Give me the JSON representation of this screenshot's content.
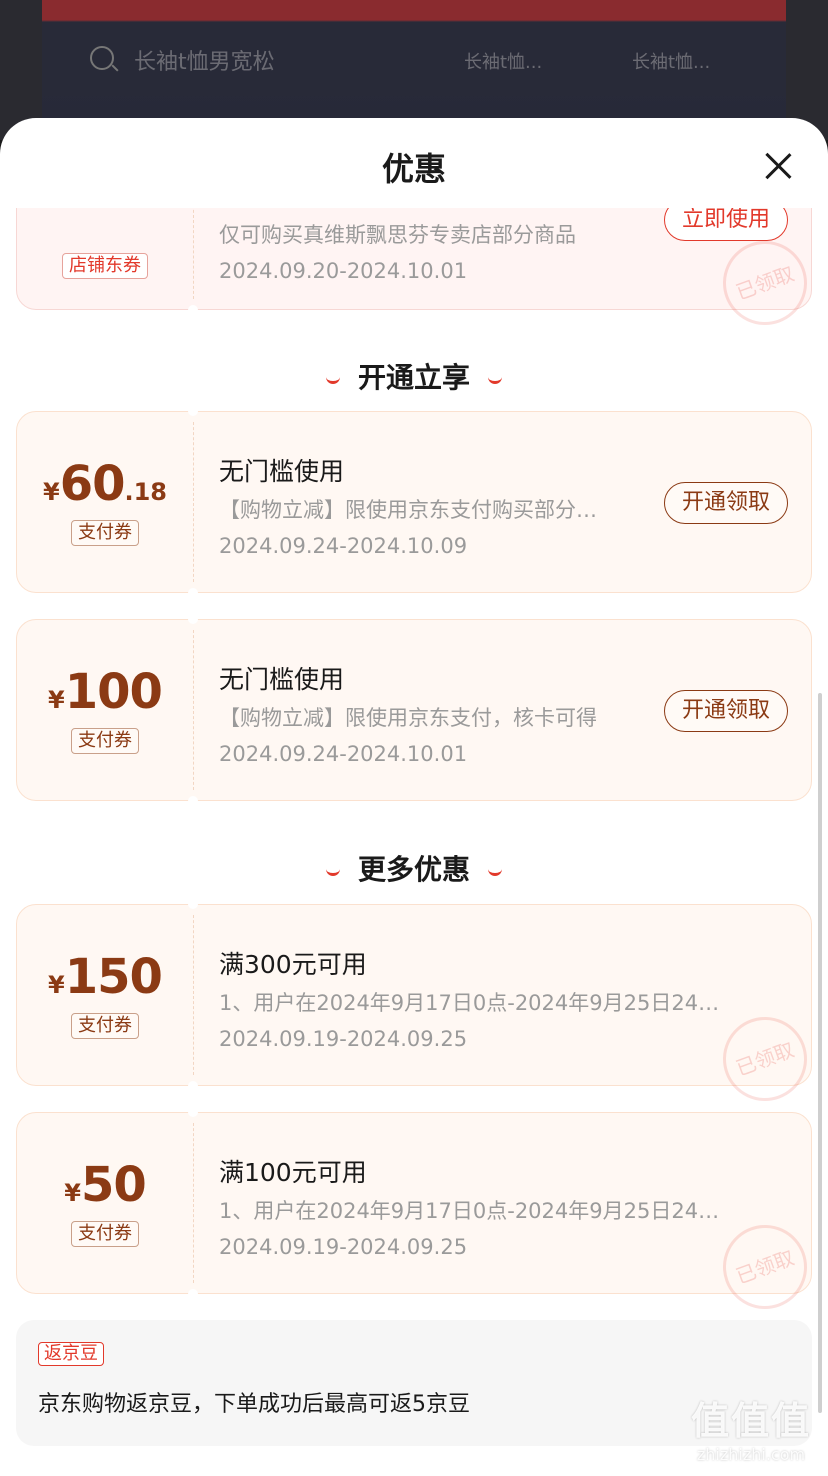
{
  "background": {
    "search_query": "长袖t恤男宽松",
    "suggestion1": "长袖t恤...",
    "suggestion2": "长袖t恤..."
  },
  "sheet": {
    "title": "优惠"
  },
  "top_coupon": {
    "tag": "店铺东券",
    "desc": "仅可购买真维斯飘思芬专卖店部分商品",
    "date": "2024.09.20-2024.10.01",
    "button": "立即使用",
    "stamp": "已领取"
  },
  "section1": {
    "title": "开通立享"
  },
  "coupons_open": [
    {
      "currency": "¥",
      "amount_int": "60",
      "amount_dec": ".18",
      "tag": "支付券",
      "title": "无门槛使用",
      "desc": "【购物立减】限使用京东支付购买部分…",
      "date": "2024.09.24-2024.10.09",
      "button": "开通领取"
    },
    {
      "currency": "¥",
      "amount_int": "100",
      "amount_dec": "",
      "tag": "支付券",
      "title": "无门槛使用",
      "desc": "【购物立减】限使用京东支付，核卡可得",
      "date": "2024.09.24-2024.10.01",
      "button": "开通领取"
    }
  ],
  "section2": {
    "title": "更多优惠"
  },
  "coupons_more": [
    {
      "currency": "¥",
      "amount_int": "150",
      "tag": "支付券",
      "title": "满300元可用",
      "desc": "1、用户在2024年9月17日0点-2024年9月25日24…",
      "date": "2024.09.19-2024.09.25",
      "stamp": "已领取"
    },
    {
      "currency": "¥",
      "amount_int": "50",
      "tag": "支付券",
      "title": "满100元可用",
      "desc": "1、用户在2024年9月17日0点-2024年9月25日24…",
      "date": "2024.09.19-2024.09.25",
      "stamp": "已领取"
    }
  ],
  "jingdou": {
    "tag": "返京豆",
    "text": "京东购物返京豆，下单成功后最高可返5京豆"
  },
  "watermark": {
    "logo": "值值值",
    "url": "zhizhizhi.com"
  },
  "colors": {
    "accent_red": "#e2392b",
    "coupon_brown": "#8b3a14",
    "coupon_bg": "#fff8f3"
  }
}
